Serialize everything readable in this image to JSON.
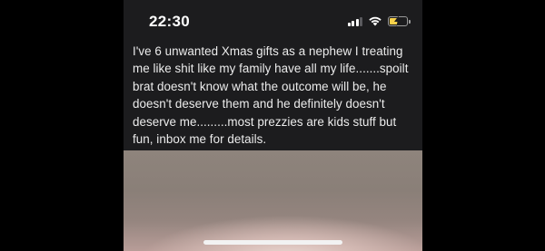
{
  "status_bar": {
    "time": "22:30",
    "icons": [
      "cellular-signal-icon",
      "wifi-icon",
      "battery-charging-icon"
    ],
    "battery_level": 0.55,
    "battery_color": "#f7d14a"
  },
  "post": {
    "text": "I've 6 unwanted Xmas gifts as a nephew I treating me like shit like my family have all my life.......spoilt brat doesn't know what the outcome will be, he doesn't deserve them and he definitely doesn't deserve me.........most prezzies are kids stuff but fun, inbox me for details."
  },
  "colors": {
    "background": "#1c1c1e",
    "text": "#ececec"
  }
}
